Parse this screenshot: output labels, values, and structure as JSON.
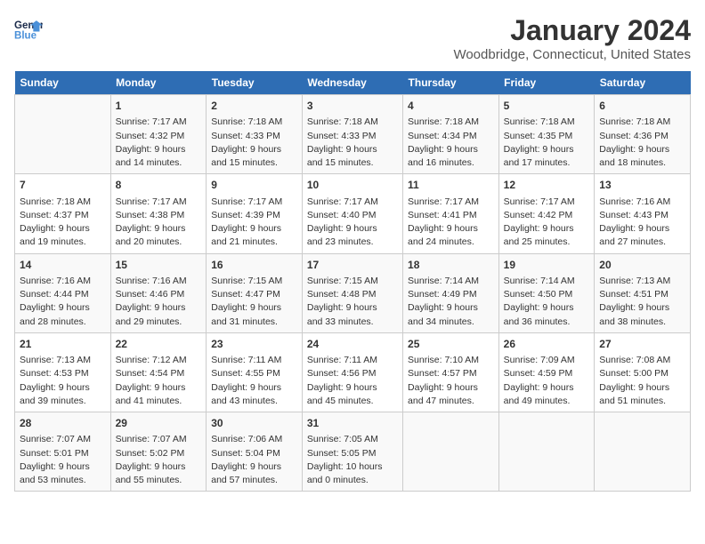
{
  "logo": {
    "line1": "General",
    "line2": "Blue"
  },
  "title": "January 2024",
  "subtitle": "Woodbridge, Connecticut, United States",
  "headers": [
    "Sunday",
    "Monday",
    "Tuesday",
    "Wednesday",
    "Thursday",
    "Friday",
    "Saturday"
  ],
  "weeks": [
    [
      {
        "num": "",
        "content": ""
      },
      {
        "num": "1",
        "content": "Sunrise: 7:17 AM\nSunset: 4:32 PM\nDaylight: 9 hours\nand 14 minutes."
      },
      {
        "num": "2",
        "content": "Sunrise: 7:18 AM\nSunset: 4:33 PM\nDaylight: 9 hours\nand 15 minutes."
      },
      {
        "num": "3",
        "content": "Sunrise: 7:18 AM\nSunset: 4:33 PM\nDaylight: 9 hours\nand 15 minutes."
      },
      {
        "num": "4",
        "content": "Sunrise: 7:18 AM\nSunset: 4:34 PM\nDaylight: 9 hours\nand 16 minutes."
      },
      {
        "num": "5",
        "content": "Sunrise: 7:18 AM\nSunset: 4:35 PM\nDaylight: 9 hours\nand 17 minutes."
      },
      {
        "num": "6",
        "content": "Sunrise: 7:18 AM\nSunset: 4:36 PM\nDaylight: 9 hours\nand 18 minutes."
      }
    ],
    [
      {
        "num": "7",
        "content": "Sunrise: 7:18 AM\nSunset: 4:37 PM\nDaylight: 9 hours\nand 19 minutes."
      },
      {
        "num": "8",
        "content": "Sunrise: 7:17 AM\nSunset: 4:38 PM\nDaylight: 9 hours\nand 20 minutes."
      },
      {
        "num": "9",
        "content": "Sunrise: 7:17 AM\nSunset: 4:39 PM\nDaylight: 9 hours\nand 21 minutes."
      },
      {
        "num": "10",
        "content": "Sunrise: 7:17 AM\nSunset: 4:40 PM\nDaylight: 9 hours\nand 23 minutes."
      },
      {
        "num": "11",
        "content": "Sunrise: 7:17 AM\nSunset: 4:41 PM\nDaylight: 9 hours\nand 24 minutes."
      },
      {
        "num": "12",
        "content": "Sunrise: 7:17 AM\nSunset: 4:42 PM\nDaylight: 9 hours\nand 25 minutes."
      },
      {
        "num": "13",
        "content": "Sunrise: 7:16 AM\nSunset: 4:43 PM\nDaylight: 9 hours\nand 27 minutes."
      }
    ],
    [
      {
        "num": "14",
        "content": "Sunrise: 7:16 AM\nSunset: 4:44 PM\nDaylight: 9 hours\nand 28 minutes."
      },
      {
        "num": "15",
        "content": "Sunrise: 7:16 AM\nSunset: 4:46 PM\nDaylight: 9 hours\nand 29 minutes."
      },
      {
        "num": "16",
        "content": "Sunrise: 7:15 AM\nSunset: 4:47 PM\nDaylight: 9 hours\nand 31 minutes."
      },
      {
        "num": "17",
        "content": "Sunrise: 7:15 AM\nSunset: 4:48 PM\nDaylight: 9 hours\nand 33 minutes."
      },
      {
        "num": "18",
        "content": "Sunrise: 7:14 AM\nSunset: 4:49 PM\nDaylight: 9 hours\nand 34 minutes."
      },
      {
        "num": "19",
        "content": "Sunrise: 7:14 AM\nSunset: 4:50 PM\nDaylight: 9 hours\nand 36 minutes."
      },
      {
        "num": "20",
        "content": "Sunrise: 7:13 AM\nSunset: 4:51 PM\nDaylight: 9 hours\nand 38 minutes."
      }
    ],
    [
      {
        "num": "21",
        "content": "Sunrise: 7:13 AM\nSunset: 4:53 PM\nDaylight: 9 hours\nand 39 minutes."
      },
      {
        "num": "22",
        "content": "Sunrise: 7:12 AM\nSunset: 4:54 PM\nDaylight: 9 hours\nand 41 minutes."
      },
      {
        "num": "23",
        "content": "Sunrise: 7:11 AM\nSunset: 4:55 PM\nDaylight: 9 hours\nand 43 minutes."
      },
      {
        "num": "24",
        "content": "Sunrise: 7:11 AM\nSunset: 4:56 PM\nDaylight: 9 hours\nand 45 minutes."
      },
      {
        "num": "25",
        "content": "Sunrise: 7:10 AM\nSunset: 4:57 PM\nDaylight: 9 hours\nand 47 minutes."
      },
      {
        "num": "26",
        "content": "Sunrise: 7:09 AM\nSunset: 4:59 PM\nDaylight: 9 hours\nand 49 minutes."
      },
      {
        "num": "27",
        "content": "Sunrise: 7:08 AM\nSunset: 5:00 PM\nDaylight: 9 hours\nand 51 minutes."
      }
    ],
    [
      {
        "num": "28",
        "content": "Sunrise: 7:07 AM\nSunset: 5:01 PM\nDaylight: 9 hours\nand 53 minutes."
      },
      {
        "num": "29",
        "content": "Sunrise: 7:07 AM\nSunset: 5:02 PM\nDaylight: 9 hours\nand 55 minutes."
      },
      {
        "num": "30",
        "content": "Sunrise: 7:06 AM\nSunset: 5:04 PM\nDaylight: 9 hours\nand 57 minutes."
      },
      {
        "num": "31",
        "content": "Sunrise: 7:05 AM\nSunset: 5:05 PM\nDaylight: 10 hours\nand 0 minutes."
      },
      {
        "num": "",
        "content": ""
      },
      {
        "num": "",
        "content": ""
      },
      {
        "num": "",
        "content": ""
      }
    ]
  ]
}
